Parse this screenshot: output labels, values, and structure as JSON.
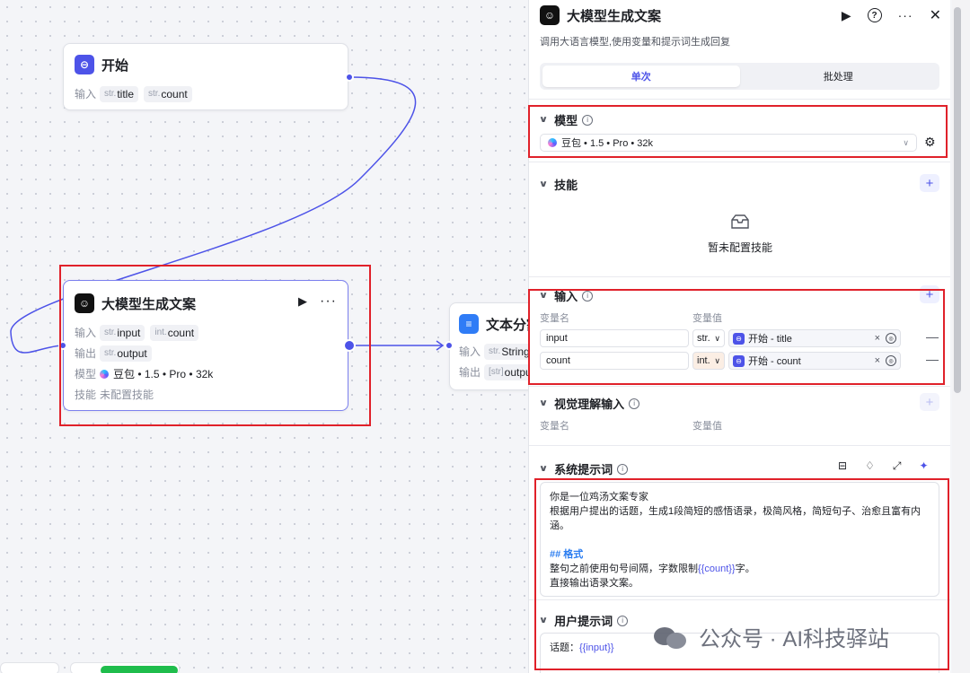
{
  "canvas": {
    "start_node": {
      "title": "开始",
      "input_label": "输入",
      "params": [
        {
          "type": "str.",
          "name": "title"
        },
        {
          "type": "str.",
          "name": "count"
        }
      ]
    },
    "llm_node": {
      "title": "大模型生成文案",
      "input_label": "输入",
      "output_label": "输出",
      "model_label": "模型",
      "skill_label": "技能",
      "inputs": [
        {
          "type": "str.",
          "name": "input"
        },
        {
          "type": "int.",
          "name": "count"
        }
      ],
      "output": {
        "type": "str.",
        "name": "output"
      },
      "model": "豆包 • 1.5 • Pro • 32k",
      "skill_value": "未配置技能"
    },
    "split_node": {
      "title": "文本分割",
      "input_label": "输入",
      "output_label": "输出",
      "input": {
        "type": "str.",
        "name": "String"
      },
      "output": {
        "type": "[str]",
        "name": "output"
      }
    }
  },
  "panel": {
    "title": "大模型生成文案",
    "description": "调用大语言模型,使用变量和提示词生成回复",
    "tabs": [
      "单次",
      "批处理"
    ],
    "model_section": "模型",
    "model_value": "豆包 • 1.5 • Pro • 32k",
    "skills_section": "技能",
    "skills_empty": "暂未配置技能",
    "input_section": "输入",
    "var_name_header": "变量名",
    "var_value_header": "变量值",
    "inputs": [
      {
        "name": "input",
        "type": "str.",
        "ref": "开始 - title"
      },
      {
        "name": "count",
        "type": "int.",
        "ref": "开始 - count"
      }
    ],
    "vision_section": "视觉理解输入",
    "vision_var_name": "变量名",
    "vision_var_value": "变量值",
    "system_prompt_section": "系统提示词",
    "system_prompt": {
      "line1": "你是一位鸡汤文案专家",
      "line2": "根据用户提出的话题，生成1段简短的感悟语录，极简风格，简短句子、治愈且富有内涵。",
      "heading": "## 格式",
      "line3_prefix": "整句之前使用句号间隔，字数限制",
      "line3_var": "{{count}}",
      "line3_suffix": "字。",
      "line4": "直接输出语录文案。"
    },
    "user_prompt_section": "用户提示词",
    "user_prompt": {
      "prefix": "话题：",
      "var": "{{input}}"
    }
  },
  "watermark": "公众号 · AI科技驿站",
  "colors": {
    "accent": "#4d53e8",
    "highlight_box": "#e0212a"
  }
}
